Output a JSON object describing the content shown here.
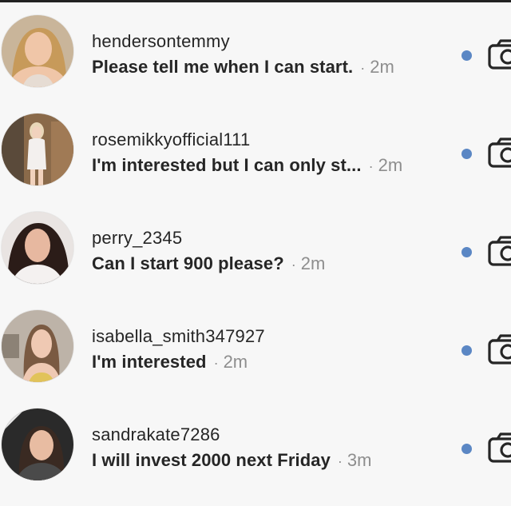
{
  "threads": [
    {
      "username": "hendersontemmy",
      "preview": "Please tell me when I can start.",
      "separator": "·",
      "time": "2m",
      "unread": true,
      "avatar_colors": {
        "bg": "#c9b59a",
        "hair": "#c79a5a",
        "skin": "#f0c6a8",
        "clothing": "#e6dcd3"
      }
    },
    {
      "username": "rosemikkyofficial111",
      "preview": "I'm interested but I can only st...",
      "separator": "·",
      "time": "2m",
      "unread": true,
      "avatar_colors": {
        "bg": "#8a6a4a",
        "hair": "#e8d7b8",
        "skin": "#f1d2bd",
        "clothing": "#f3f0ee"
      }
    },
    {
      "username": "perry_2345",
      "preview": "Can I start 900 please?",
      "separator": "·",
      "time": "2m",
      "unread": true,
      "avatar_colors": {
        "bg": "#e9e4e2",
        "hair": "#2b1c18",
        "skin": "#e7b8a0",
        "clothing": "#f4f1f0"
      }
    },
    {
      "username": "isabella_smith347927",
      "preview": "I'm interested",
      "separator": "·",
      "time": "2m",
      "unread": true,
      "avatar_colors": {
        "bg": "#bdb3a8",
        "hair": "#7a5a42",
        "skin": "#efc9b3",
        "clothing": "#e1c35a"
      }
    },
    {
      "username": "sandrakate7286",
      "preview": "I will invest 2000 next Friday",
      "separator": "·",
      "time": "3m",
      "unread": true,
      "avatar_colors": {
        "bg": "#2a2a2a",
        "hair": "#3a2a22",
        "skin": "#e8bca2",
        "clothing": "#4a4a4a"
      }
    }
  ],
  "unread_color": "#5b87c4",
  "icons": {
    "thread_action": "camera-icon",
    "status": "unread-dot"
  }
}
